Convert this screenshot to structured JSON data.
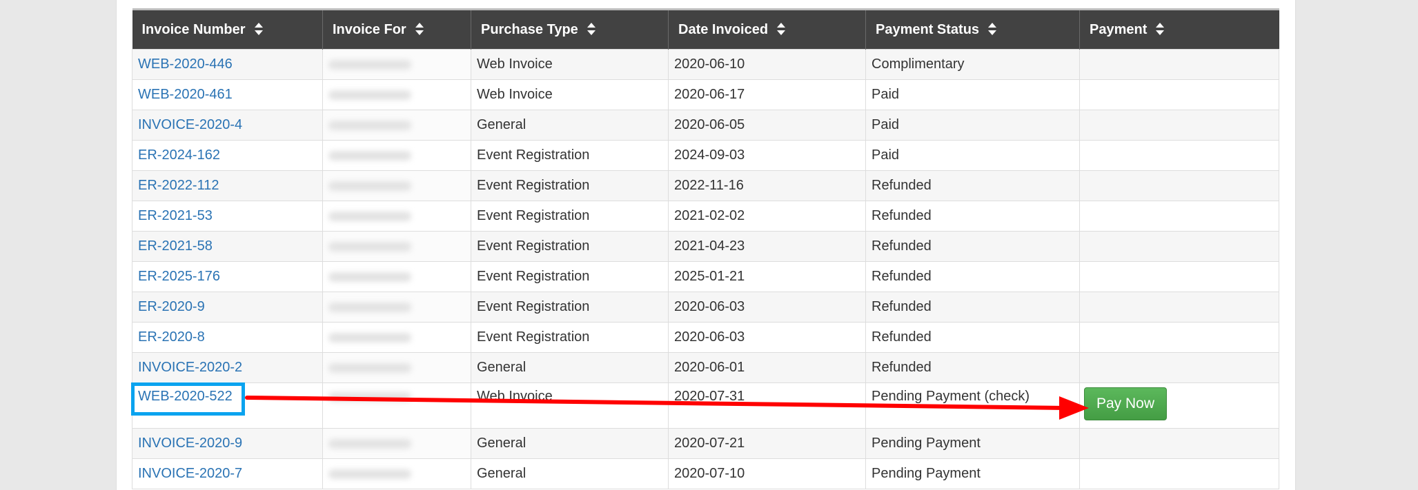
{
  "table": {
    "headers": [
      {
        "label": "Invoice Number"
      },
      {
        "label": "Invoice For"
      },
      {
        "label": "Purchase Type"
      },
      {
        "label": "Date Invoiced"
      },
      {
        "label": "Payment Status"
      },
      {
        "label": "Payment"
      }
    ],
    "rows": [
      {
        "invoice_number": "WEB-2020-446",
        "invoice_for": "",
        "purchase_type": "Web Invoice",
        "date_invoiced": "2020-06-10",
        "payment_status": "Complimentary",
        "payment": ""
      },
      {
        "invoice_number": "WEB-2020-461",
        "invoice_for": "",
        "purchase_type": "Web Invoice",
        "date_invoiced": "2020-06-17",
        "payment_status": "Paid",
        "payment": ""
      },
      {
        "invoice_number": "INVOICE-2020-4",
        "invoice_for": "",
        "purchase_type": "General",
        "date_invoiced": "2020-06-05",
        "payment_status": "Paid",
        "payment": ""
      },
      {
        "invoice_number": "ER-2024-162",
        "invoice_for": "",
        "purchase_type": "Event Registration",
        "date_invoiced": "2024-09-03",
        "payment_status": "Paid",
        "payment": ""
      },
      {
        "invoice_number": "ER-2022-112",
        "invoice_for": "",
        "purchase_type": "Event Registration",
        "date_invoiced": "2022-11-16",
        "payment_status": "Refunded",
        "payment": ""
      },
      {
        "invoice_number": "ER-2021-53",
        "invoice_for": "",
        "purchase_type": "Event Registration",
        "date_invoiced": "2021-02-02",
        "payment_status": "Refunded",
        "payment": ""
      },
      {
        "invoice_number": "ER-2021-58",
        "invoice_for": "",
        "purchase_type": "Event Registration",
        "date_invoiced": "2021-04-23",
        "payment_status": "Refunded",
        "payment": ""
      },
      {
        "invoice_number": "ER-2025-176",
        "invoice_for": "",
        "purchase_type": "Event Registration",
        "date_invoiced": "2025-01-21",
        "payment_status": "Refunded",
        "payment": ""
      },
      {
        "invoice_number": "ER-2020-9",
        "invoice_for": "",
        "purchase_type": "Event Registration",
        "date_invoiced": "2020-06-03",
        "payment_status": "Refunded",
        "payment": ""
      },
      {
        "invoice_number": "ER-2020-8",
        "invoice_for": "",
        "purchase_type": "Event Registration",
        "date_invoiced": "2020-06-03",
        "payment_status": "Refunded",
        "payment": ""
      },
      {
        "invoice_number": "INVOICE-2020-2",
        "invoice_for": "",
        "purchase_type": "General",
        "date_invoiced": "2020-06-01",
        "payment_status": "Refunded",
        "payment": ""
      },
      {
        "invoice_number": "WEB-2020-522",
        "invoice_for": "",
        "purchase_type": "Web Invoice",
        "date_invoiced": "2020-07-31",
        "payment_status": "Pending Payment (check)",
        "payment": "Pay Now"
      },
      {
        "invoice_number": "INVOICE-2020-9",
        "invoice_for": "",
        "purchase_type": "General",
        "date_invoiced": "2020-07-21",
        "payment_status": "Pending Payment",
        "payment": ""
      },
      {
        "invoice_number": "INVOICE-2020-7",
        "invoice_for": "",
        "purchase_type": "General",
        "date_invoiced": "2020-07-10",
        "payment_status": "Pending Payment",
        "payment": ""
      }
    ]
  },
  "annotation": {
    "highlight_color": "#0aa3ef",
    "arrow_color": "#ff0000"
  },
  "colors": {
    "header_bg": "#424242",
    "link": "#2a73b4",
    "pay_button": "#5cb85c"
  },
  "icons": {
    "sort": "sort-up-down-icon"
  }
}
